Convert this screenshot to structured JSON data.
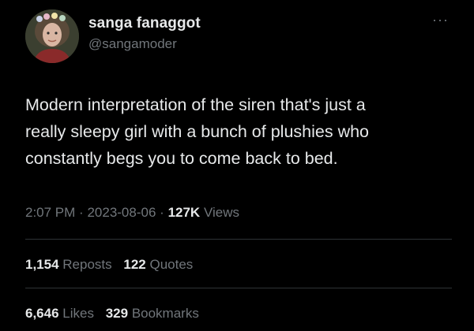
{
  "user": {
    "display_name": "sanga fanaggot",
    "handle": "@sangamoder"
  },
  "tweet": {
    "text": "Modern interpretation of the siren that's just a\nreally sleepy girl with a bunch of plushies who\nconstantly begs you to come back to bed.",
    "time": "2:07 PM",
    "date": "2023-08-06",
    "separator": "·",
    "views_count": "127K",
    "views_label": "Views"
  },
  "stats": {
    "reposts_count": "1,154",
    "reposts_label": "Reposts",
    "quotes_count": "122",
    "quotes_label": "Quotes",
    "likes_count": "6,646",
    "likes_label": "Likes",
    "bookmarks_count": "329",
    "bookmarks_label": "Bookmarks"
  },
  "icons": {
    "more": "more-options-icon"
  },
  "colors": {
    "background": "#000000",
    "primary_text": "#e7e9ea",
    "secondary_text": "#71767b",
    "divider": "#2f3336"
  }
}
